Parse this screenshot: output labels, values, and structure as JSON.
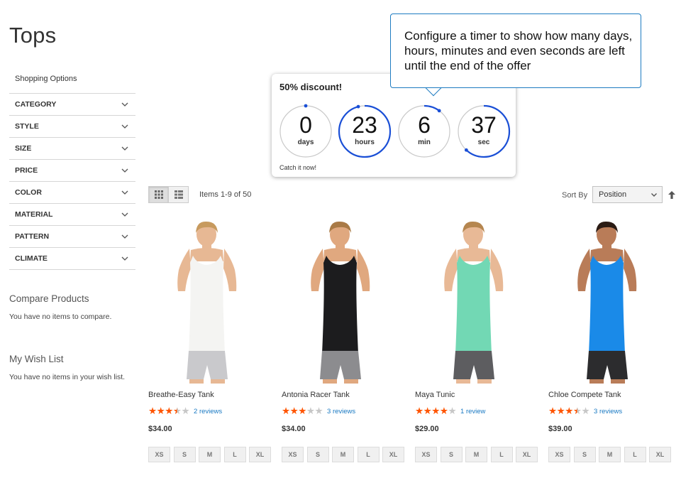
{
  "page": {
    "title": "Tops"
  },
  "sidebar": {
    "shopping_options": "Shopping Options",
    "filters": [
      "CATEGORY",
      "STYLE",
      "SIZE",
      "PRICE",
      "COLOR",
      "MATERIAL",
      "PATTERN",
      "CLIMATE"
    ],
    "compare_title": "Compare Products",
    "compare_text": "You have no items to compare.",
    "wishlist_title": "My Wish List",
    "wishlist_text": "You have no items in your wish list."
  },
  "toolbar": {
    "amount": "Items 1-9 of 50",
    "sort_label": "Sort By",
    "sort_value": "Position",
    "icons": {
      "grid": "grid-icon",
      "list": "list-icon",
      "sort_direction": "arrow-up-icon"
    }
  },
  "products": [
    {
      "name": "Breathe-Easy Tank",
      "rating_stars": 3.5,
      "reviews": "2 reviews",
      "price": "$34.00",
      "sizes": [
        "XS",
        "S",
        "M",
        "L",
        "XL"
      ],
      "top_color": "#f4f4f2",
      "bottom_color": "#c9c9cc",
      "skin": "#e7b894",
      "hair": "#c79a5e"
    },
    {
      "name": "Antonia Racer Tank",
      "rating_stars": 3,
      "reviews": "3 reviews",
      "price": "$34.00",
      "sizes": [
        "XS",
        "S",
        "M",
        "L",
        "XL"
      ],
      "top_color": "#1c1c1e",
      "bottom_color": "#8c8c8f",
      "skin": "#e0a87f",
      "hair": "#a97a46"
    },
    {
      "name": "Maya Tunic",
      "rating_stars": 4,
      "reviews": "1 review",
      "price": "$29.00",
      "sizes": [
        "XS",
        "S",
        "M",
        "L",
        "XL"
      ],
      "top_color": "#72d8b4",
      "bottom_color": "#5d5d60",
      "skin": "#e8b996",
      "hair": "#b5864f"
    },
    {
      "name": "Chloe Compete Tank",
      "rating_stars": 3.5,
      "reviews": "3 reviews",
      "price": "$39.00",
      "sizes": [
        "XS",
        "S",
        "M",
        "L",
        "XL"
      ],
      "top_color": "#1a8ae8",
      "bottom_color": "#2c2c2e",
      "skin": "#b97c58",
      "hair": "#2a1b14"
    }
  ],
  "timer": {
    "title": "50% discount!",
    "units": [
      {
        "value": "0",
        "label": "days",
        "progress": 0.0
      },
      {
        "value": "23",
        "label": "hours",
        "progress": 0.96
      },
      {
        "value": "6",
        "label": "min",
        "progress": 0.1
      },
      {
        "value": "37",
        "label": "sec",
        "progress": 0.62
      }
    ],
    "note": "Catch it now!",
    "accent": "#1a4fd6"
  },
  "callout": {
    "text": "Configure a timer to show how many days, hours, minutes and even seconds are left until the end of the offer"
  }
}
